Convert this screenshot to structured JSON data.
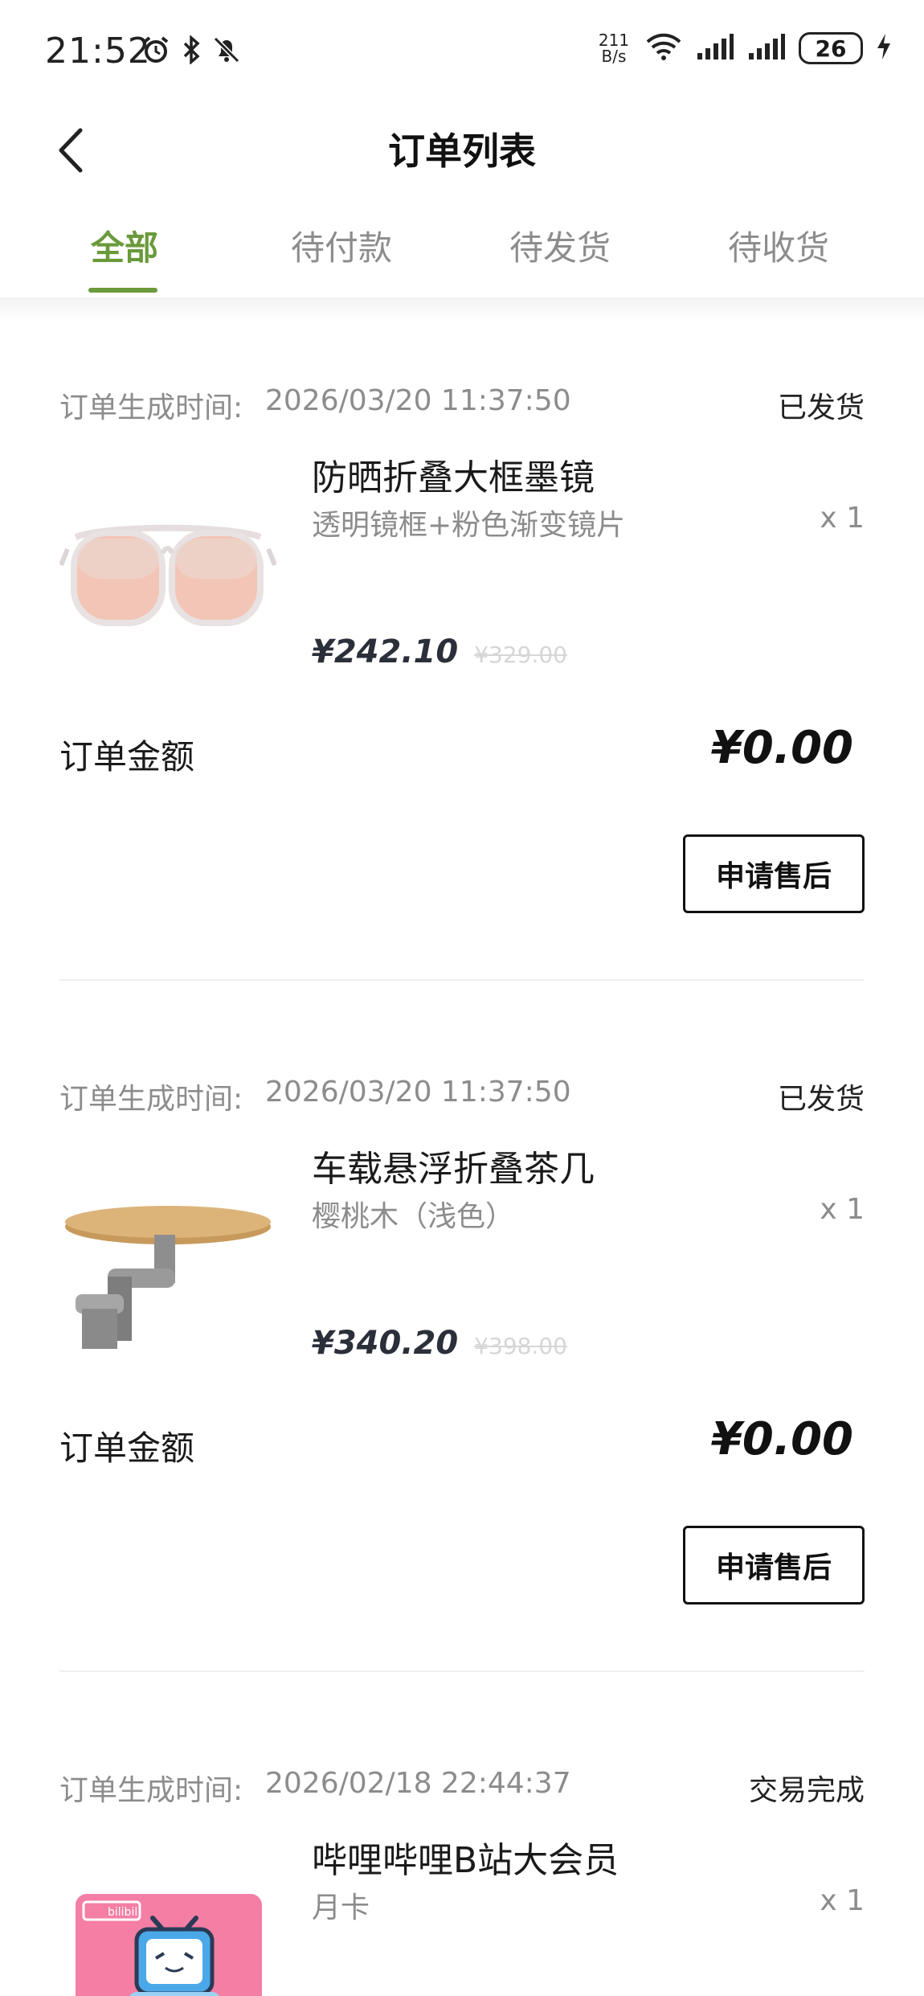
{
  "status_bar": {
    "time": "21:52",
    "net_speed_value": "211",
    "net_speed_unit": "B/s",
    "battery": "26",
    "icons": [
      "alarm-icon",
      "bluetooth-icon",
      "mute-icon",
      "wifi-icon",
      "signal-icon",
      "signal-icon",
      "charging-icon"
    ]
  },
  "header": {
    "title": "订单列表",
    "back_icon": "back-arrow-icon"
  },
  "tabs": [
    {
      "label": "全部",
      "active": true
    },
    {
      "label": "待付款",
      "active": false
    },
    {
      "label": "待发货",
      "active": false
    },
    {
      "label": "待收货",
      "active": false
    }
  ],
  "accent_color": "#6a9a3a",
  "orders": [
    {
      "time_label": "订单生成时间:",
      "time": "2026/03/20 11:37:50",
      "status": "已发货",
      "product_name": "防晒折叠大框墨镜",
      "product_spec": "透明镜框+粉色渐变镜片",
      "qty": "x 1",
      "price": "¥242.10",
      "original_price": "¥329.00",
      "amount_label": "订单金额",
      "amount": "¥0.00",
      "action": "申请售后"
    },
    {
      "time_label": "订单生成时间:",
      "time": "2026/03/20 11:37:50",
      "status": "已发货",
      "product_name": "车载悬浮折叠茶几",
      "product_spec": "樱桃木（浅色）",
      "qty": "x 1",
      "price": "¥340.20",
      "original_price": "¥398.00",
      "amount_label": "订单金额",
      "amount": "¥0.00",
      "action": "申请售后"
    },
    {
      "time_label": "订单生成时间:",
      "time": "2026/02/18 22:44:37",
      "status": "交易完成",
      "product_name": "哔哩哔哩B站大会员",
      "product_spec": "月卡",
      "qty": "x 1",
      "logo_text": "bilibili"
    }
  ]
}
